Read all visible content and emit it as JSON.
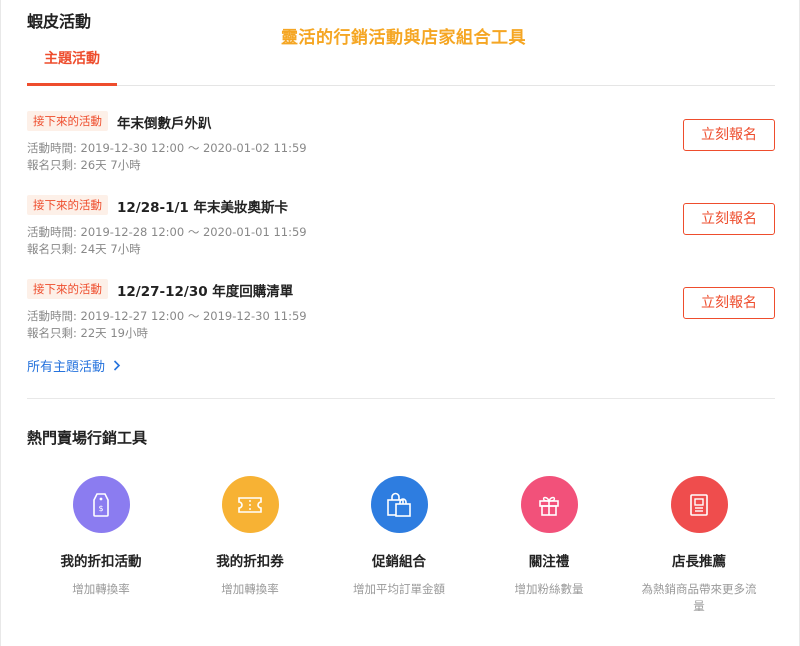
{
  "page": {
    "section_title": "蝦皮活動",
    "headline": "靈活的行銷活動與店家組合工具",
    "tab_label": "主題活動"
  },
  "events": [
    {
      "badge": "接下來的活動",
      "title": "年末倒數戶外趴",
      "time": "活動時間: 2019-12-30 12:00 ～ 2020-01-02 11:59",
      "remain": "報名只剩:  26天 7小時",
      "button": "立刻報名"
    },
    {
      "badge": "接下來的活動",
      "title": "12/28-1/1 年末美妝奧斯卡",
      "time": "活動時間: 2019-12-28 12:00 ～ 2020-01-01 11:59",
      "remain": "報名只剩:  24天 7小時",
      "button": "立刻報名"
    },
    {
      "badge": "接下來的活動",
      "title": "12/27-12/30 年度回購清單",
      "time": "活動時間: 2019-12-27 12:00 ～ 2019-12-30 11:59",
      "remain": "報名只剩:  22天 19小時",
      "button": "立刻報名"
    }
  ],
  "all_events_link": "所有主題活動",
  "tools_section": {
    "title": "熱門賣場行銷工具",
    "tools": [
      {
        "name": "我的折扣活動",
        "desc": "增加轉換率",
        "icon": "price-tag-icon",
        "color": "#8b7cf0"
      },
      {
        "name": "我的折扣券",
        "desc": "增加轉換率",
        "icon": "ticket-icon",
        "color": "#f7b234"
      },
      {
        "name": "促銷組合",
        "desc": "增加平均訂單金額",
        "icon": "shopping-bags-icon",
        "color": "#2e7de0"
      },
      {
        "name": "關注禮",
        "desc": "增加粉絲數量",
        "icon": "gift-icon",
        "color": "#f2517a"
      },
      {
        "name": "店長推薦",
        "desc": "為熱銷商品帶來更多流量",
        "icon": "recommend-list-icon",
        "color": "#ef4d4d"
      }
    ]
  }
}
